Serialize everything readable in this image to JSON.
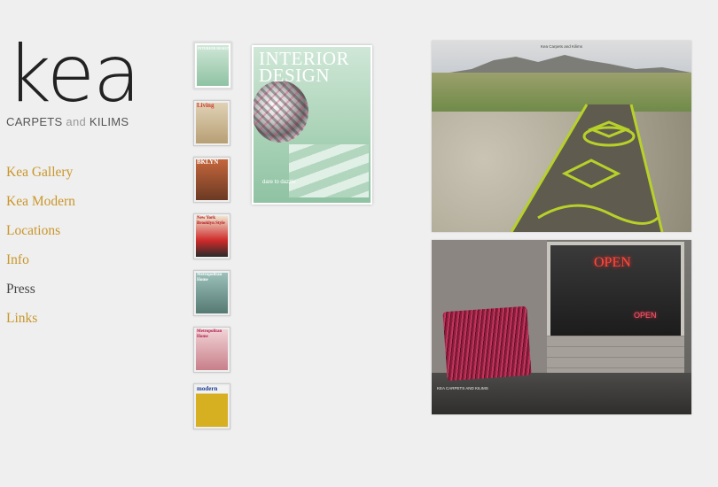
{
  "brand": {
    "logo": "kea",
    "subtitle_pre": "CARPETS ",
    "subtitle_and": "and",
    "subtitle_post": " KILIMS"
  },
  "nav": {
    "items": [
      {
        "label": "Kea Gallery",
        "active": false
      },
      {
        "label": "Kea Modern",
        "active": false
      },
      {
        "label": "Locations",
        "active": false
      },
      {
        "label": "Info",
        "active": false
      },
      {
        "label": "Press",
        "active": true
      },
      {
        "label": "Links",
        "active": false
      }
    ]
  },
  "thumbnails": [
    {
      "title": "INTERIOR DESIGN",
      "color": "#a5cdb2",
      "selected": true
    },
    {
      "title": "Living",
      "color": "#d8c8a8",
      "selected": false
    },
    {
      "title": "BKLYN",
      "color": "#b8532f",
      "selected": false
    },
    {
      "title": "New York Brooklyn Style",
      "color": "#e8dfc8",
      "selected": false
    },
    {
      "title": "Metropolitan Home",
      "color": "#7fa6a0",
      "selected": false
    },
    {
      "title": "Metropolitan Home",
      "color": "#e7c2c6",
      "selected": false
    },
    {
      "title": "modern",
      "color": "#d6b021",
      "selected": false
    }
  ],
  "cover": {
    "title_line1": "INTERIOR",
    "title_line2": "DESIGN",
    "tag": "dare to dazzle"
  },
  "photos": {
    "top_caption": "Kea Carpets and Kilims",
    "open_sign": "OPEN",
    "open_sign2": "OPEN",
    "bottom_caption": "KEA CARPETS AND KILIMS"
  },
  "colors": {
    "background": "#efefef",
    "nav_link": "#c9962a",
    "nav_active": "#444444"
  }
}
